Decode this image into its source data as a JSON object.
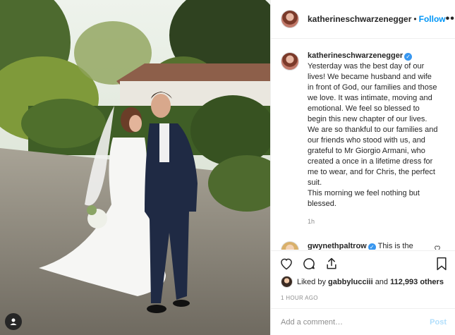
{
  "post": {
    "username": "katherineschwarzenegger",
    "follow_label": "Follow",
    "separator": "•",
    "more_label": "•••"
  },
  "caption": {
    "username": "katherineschwarzenegger",
    "verified": "✓",
    "text": "Yesterday was the best day of our lives! We became husband and wife in front of God, our families and those we love. It was intimate, moving and emotional. We feel so blessed to begin this new chapter of our lives. We are so thankful to our families and our friends who stood with us, and grateful to Mr Giorgio Armani, who created a once in a lifetime dress for me to wear, and for Chris, the perfect suit.\nThis morning we feel nothing but blessed.",
    "time": "1h"
  },
  "comment": {
    "username": "gwynethpaltrow",
    "verified": "✓",
    "text": "This is the sweetest!!!! Congratulations you"
  },
  "likes": {
    "prefix": "Liked by",
    "first_user": "gabbylucciii",
    "connector": "and",
    "count_text": "112,993 others"
  },
  "timestamp": "1 HOUR AGO",
  "add_comment": {
    "placeholder": "Add a comment…",
    "post_label": "Post"
  },
  "colors": {
    "accent": "#0095f6",
    "verified": "#3897f0",
    "muted": "#8e8e8e",
    "post_disabled": "#b2dffc"
  },
  "icons": [
    "user-tag-icon",
    "heart-icon",
    "comment-icon",
    "share-icon",
    "bookmark-icon"
  ]
}
